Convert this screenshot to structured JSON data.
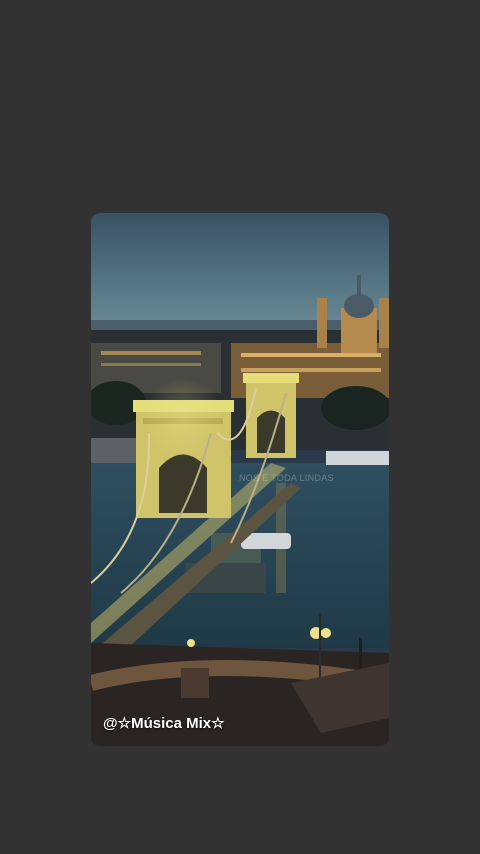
{
  "post": {
    "caption": "@☆Música Mix☆",
    "watermark": "NOS É TODA LINDAS",
    "media_description_icon": "city-night-photo"
  },
  "colors": {
    "background": "#333232",
    "sky_top": "#3d5466",
    "sky_bottom": "#5f7e8d",
    "river": "#2d4d5c",
    "bridge_light": "#e5dc7a",
    "building_glow": "#c9a25a"
  }
}
